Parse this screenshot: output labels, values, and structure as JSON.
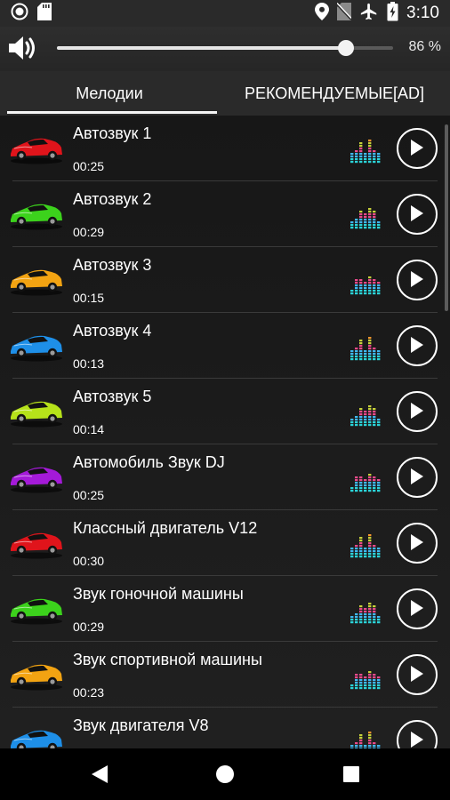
{
  "status_bar": {
    "time": "3:10",
    "left_icons": [
      "record-icon",
      "sd-card-icon"
    ],
    "right_icons": [
      "location-icon",
      "no-sim-icon",
      "airplane-icon",
      "battery-charging-icon"
    ]
  },
  "volume": {
    "percent_label": "86 %",
    "level": 0.86
  },
  "tabs": [
    {
      "label": "Мелодии",
      "active": true
    },
    {
      "label": "РЕКОМЕНДУЕМЫЕ[AD]",
      "active": false
    }
  ],
  "tracks": [
    {
      "title": "Автозвук 1",
      "duration": "00:25",
      "car_color": "#e0141b"
    },
    {
      "title": "Автозвук 2",
      "duration": "00:29",
      "car_color": "#3cd21c"
    },
    {
      "title": "Автозвук 3",
      "duration": "00:15",
      "car_color": "#f2a312"
    },
    {
      "title": "Автозвук 4",
      "duration": "00:13",
      "car_color": "#1e8fe8"
    },
    {
      "title": "Автозвук 5",
      "duration": "00:14",
      "car_color": "#b6e21a"
    },
    {
      "title": "Автомобиль Звук DJ",
      "duration": "00:25",
      "car_color": "#a41ad8"
    },
    {
      "title": "Классный двигатель V12",
      "duration": "00:30",
      "car_color": "#e0141b"
    },
    {
      "title": "Звук гоночной машины",
      "duration": "00:29",
      "car_color": "#3cd21c"
    },
    {
      "title": "Звук спортивной машины",
      "duration": "00:23",
      "car_color": "#f2a312"
    },
    {
      "title": "Звук двигателя V8",
      "duration": "",
      "car_color": "#1e8fe8"
    }
  ],
  "nav": [
    "back-icon",
    "home-icon",
    "recents-icon"
  ]
}
